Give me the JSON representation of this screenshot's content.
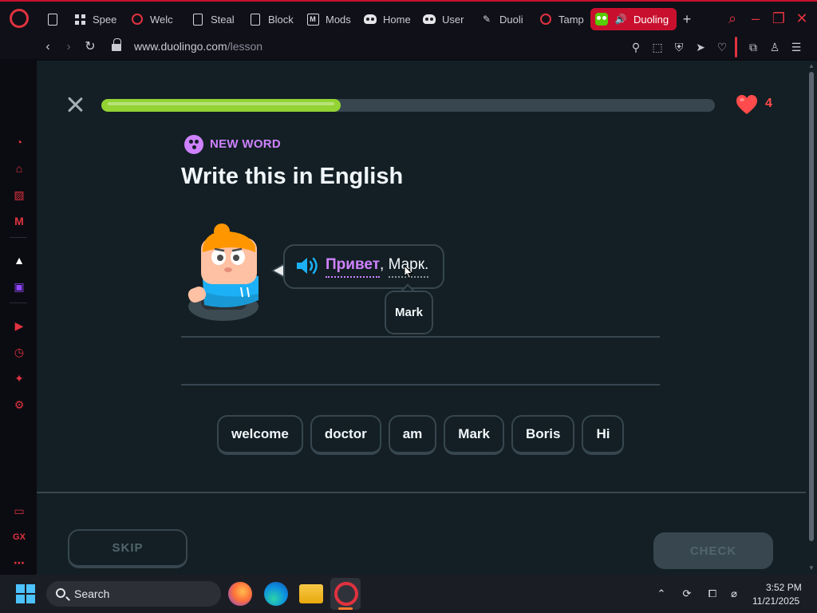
{
  "browser": {
    "tabs": [
      {
        "label": "Spee",
        "icon": "grid-icon"
      },
      {
        "label": "Welc",
        "icon": "opera-icon"
      },
      {
        "label": "Steal",
        "icon": "doc-icon"
      },
      {
        "label": "Block",
        "icon": "doc-icon"
      },
      {
        "label": "Mods",
        "icon": "m-icon"
      },
      {
        "label": "Home",
        "icon": "mask-icon"
      },
      {
        "label": "User",
        "icon": "mask-icon"
      },
      {
        "label": "Duoli",
        "icon": "tool-icon"
      },
      {
        "label": "Tamp",
        "icon": "opera-icon"
      },
      {
        "label": "Duoling",
        "icon": "duolingo-icon",
        "active": true
      }
    ],
    "address": {
      "domain": "www.duolingo.com",
      "path": "/lesson"
    },
    "accent_color": "#c8102e"
  },
  "lesson": {
    "progress": 0.39,
    "hearts": "4",
    "badge_label": "NEW WORD",
    "title": "Write this in English",
    "phrase_word1": "Привет",
    "phrase_comma": ",",
    "phrase_word2": "Марк.",
    "tooltip": "Mark",
    "word_bank": [
      "welcome",
      "doctor",
      "am",
      "Mark",
      "Boris",
      "Hi"
    ],
    "skip_label": "SKIP",
    "check_label": "CHECK",
    "colors": {
      "background": "#131f24",
      "progress": "#93d333",
      "accent": "#ce82ff",
      "heart": "#ff4b4b"
    }
  },
  "taskbar": {
    "search_label": "Search",
    "time": "3:52 PM",
    "date": "11/21/2025"
  }
}
